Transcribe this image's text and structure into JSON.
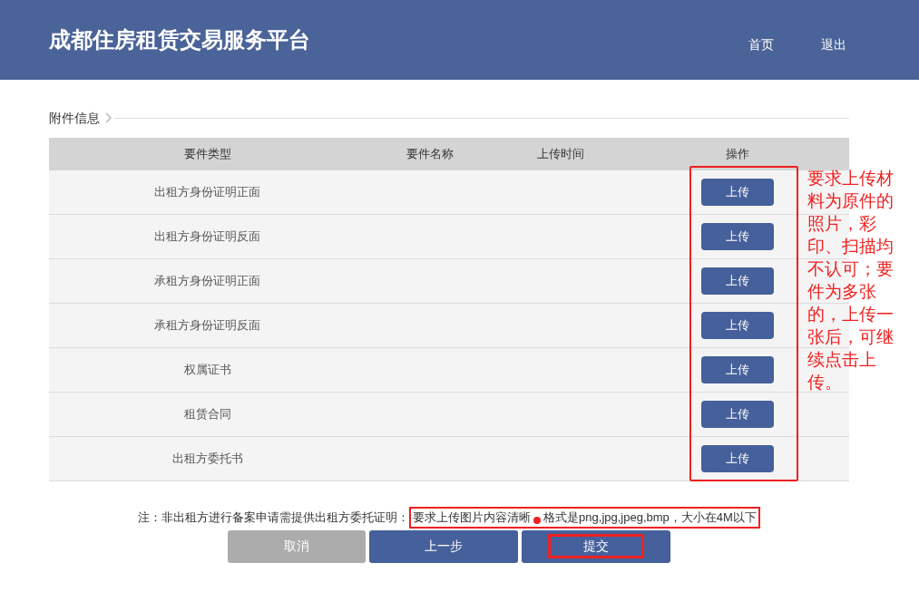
{
  "header": {
    "title": "成都住房租赁交易服务平台",
    "nav": [
      {
        "label": "首页"
      },
      {
        "label": "退出"
      }
    ]
  },
  "section": {
    "title": "附件信息"
  },
  "table": {
    "columns": [
      "要件类型",
      "要件名称",
      "上传时间",
      "操作"
    ],
    "rows": [
      {
        "type": "出租方身份证明正面",
        "action": "上传"
      },
      {
        "type": "出租方身份证明反面",
        "action": "上传"
      },
      {
        "type": "承租方身份证明正面",
        "action": "上传"
      },
      {
        "type": "承租方身份证明反面",
        "action": "上传"
      },
      {
        "type": "权属证书",
        "action": "上传"
      },
      {
        "type": "租赁合同",
        "action": "上传"
      },
      {
        "type": "出租方委托书",
        "action": "上传"
      }
    ]
  },
  "annotation": "要求上传材料为原件的照片，彩印、扫描均不认可；要件为多张的，上传一张后，可继续点击上传。",
  "note": {
    "text": "注：非出租方进行备案申请需提供出租方委托证明：",
    "highlight_before_dot": "要求上传图片内容清晰",
    "highlight_after_dot": "格式是png,jpg,jpeg,bmp，大小在4M以下"
  },
  "buttons": [
    {
      "kind": "cancel",
      "label": "取消",
      "highlighted": false
    },
    {
      "kind": "primary",
      "label": "上一步",
      "highlighted": false
    },
    {
      "kind": "primary",
      "label": "提交",
      "highlighted": true
    }
  ]
}
